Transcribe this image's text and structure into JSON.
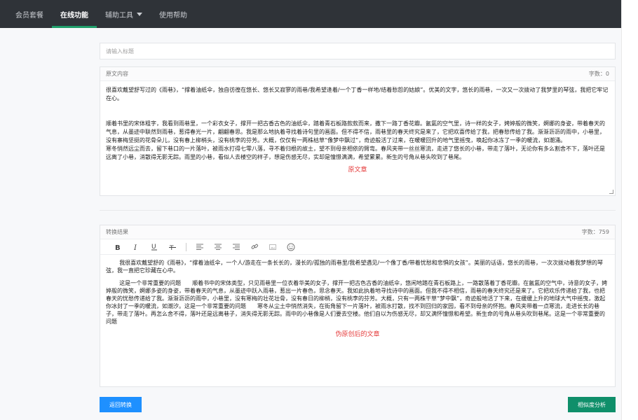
{
  "nav": {
    "items": [
      {
        "label": "会员套餐"
      },
      {
        "label": "在线功能"
      },
      {
        "label": "辅助工具"
      },
      {
        "label": "使用帮助"
      }
    ]
  },
  "title_input": {
    "placeholder": "请输入标题"
  },
  "original": {
    "header_label": "原文内容",
    "word_count": "字数：0",
    "para1": "很喜欢戴望舒写过的《雨巷》，“撑着油纸伞，独自彷徨在悠长、悠长又寂寥的雨巷/我希望逢着/一个丁香一样地/结着愁怨的姑娘”。优美的文字，悠长的雨巷，一次又一次拨动了我梦里的琴弦，我把它牢记在心。",
    "para2": "顺着书里的宋体粗字，我看到雨巷里，一个彩衣女子，撑开一把古香古色的油纸伞，踏着青石板路款款而来，撒下一路丁香花瓣。氤氲的空气里，诗一样的女子，娉婷般的微笑，婀娜的身姿，带着春天的气息，从墨迹中联然到雨巷，惹得春光一片，翩翩春思。我是那么地执着寻找着诗句里的画面。但不得不信，雨巷里的春天终究是来了，它把欢喜传给了我，把春愁传给了我。渐渐沥沥的雨中，小巷里，没有寨梅坚挺的花骨朵儿，没有春上柳梢头，没有桃李的芬芳。大概，仅仅有一两株枯草“像梦中飘过”，奇迹般活了过来，在暖暖回升的地气里摇曳，唤起你冰冻了一季的暖流，如潮涌。",
    "para3": "寒冬悄然远尘而去，留下巷口的一片落叶，被雨水打得七零八落，寻不着归根的故土，望不到母亲相依的臂弯。春风夹带一丝丝寒流，走进了悠长的小巷，带走了落叶，无论你有多么割舍不下，落叶还是远离了小巷，消散得无影无踪。雨里的小巷，看似人去楼空的样子，想是伤感无尽，实却是憧憬满满，希望累累。新生的号角从巷头吹到了巷尾。",
    "annotation": "原文章"
  },
  "result": {
    "header_label": "转换结果",
    "word_count": "字数：759",
    "para1": "我很喜欢戴望舒的《雨巷》，“撑着油纸伞，一个人/游走在一条长长的，漫长的/孤独的雨巷里/我希望遇见/一个像丁香/带着忧愁和悲惧的女孩”。美丽的话语，悠长的雨巷，一次次拨动着我梦想的琴弦，我一直把它珍藏在心中。",
    "para2": "这是一个非常重要的问题　　顺着书中的宋体类型，只见雨巷里一位衣着华美的女子，撑开一把古色古香的油纸伞，悠闲地踏在青石板路上，一路散落着丁香花瓣。在氤氲的空气中，诗意的女子，娉婷般的微笑，婀娜多姿的身姿，带着春天的气息，从墨迹中跃入雨巷，惹出一片春色，思念春天。我如此执着地寻找诗中的画面。但我不得不相信，雨巷的春天终究还是来了。它把欢乐传递给了我，也把春天的忧愁传递给了我。渐渐沥沥的雨中，小巷里，没有寒梅的壮花壮骨，没有春日的柳梢，没有桃李的芬芳。大概，只有一两株干草“梦中飘”，奇迹般地活了下来，在缓缓上升的地球大气中摇曳，激起你冰封了一季的暖流，如潮汐。这是一个非常重要的问题　　寒冬从尘土中悄然消失，在街角留下一片落叶，被雨水打散，找不到回归的家园，看不到母亲的怀抱。春风夹带着一点寒流，走进长长的巷子，带走了落叶。再怎么舍不得，落叶还是远离巷子，消失得无影无踪。雨中的小巷像是人们要去空楼。他们自以为伤感无尽，却又满怀憧憬和希望。新生命的号角从巷头吹到巷尾。这是一个非常重要的问题",
    "annotation": "伪原创后的文章"
  },
  "buttons": {
    "back": "返回转换",
    "similarity": "相似度分析"
  },
  "icons": [
    "bold-icon",
    "italic-icon",
    "underline-icon",
    "strikethrough-icon",
    "align-left-icon",
    "align-center-icon",
    "align-right-icon",
    "link-icon",
    "image-icon",
    "emoji-icon"
  ],
  "colors": {
    "nav_bg": "#2f3338",
    "nav_active_underline": "#1f9e6a",
    "annotation_red": "#e53b3b",
    "button_blue": "#1e90ff",
    "button_green": "#0f8f6a"
  }
}
